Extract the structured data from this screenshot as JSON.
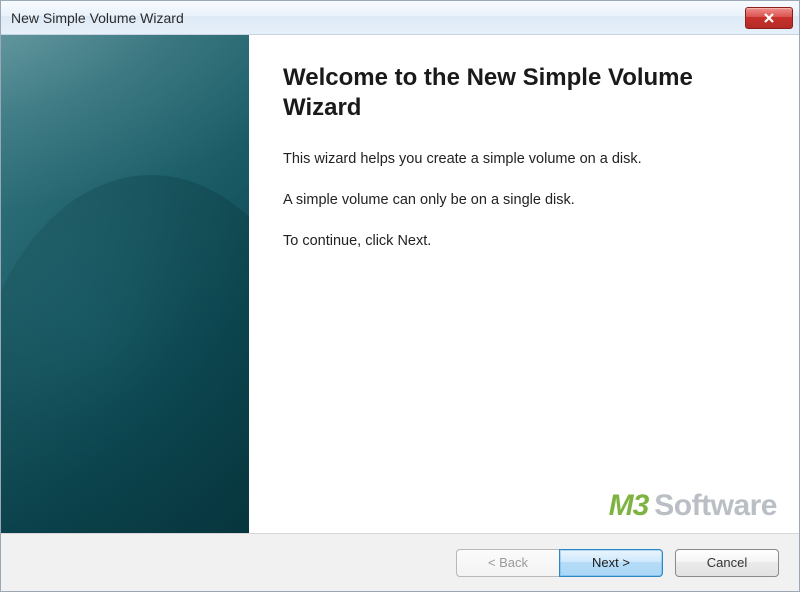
{
  "window": {
    "title": "New Simple Volume Wizard"
  },
  "heading": "Welcome to the New Simple Volume Wizard",
  "paragraphs": {
    "p1": "This wizard helps you create a simple volume on a disk.",
    "p2": "A simple volume can only be on a single disk.",
    "p3": "To continue, click Next."
  },
  "buttons": {
    "back": "< Back",
    "next": "Next >",
    "cancel": "Cancel"
  },
  "watermark": {
    "brand": "M3",
    "word": "Software"
  }
}
